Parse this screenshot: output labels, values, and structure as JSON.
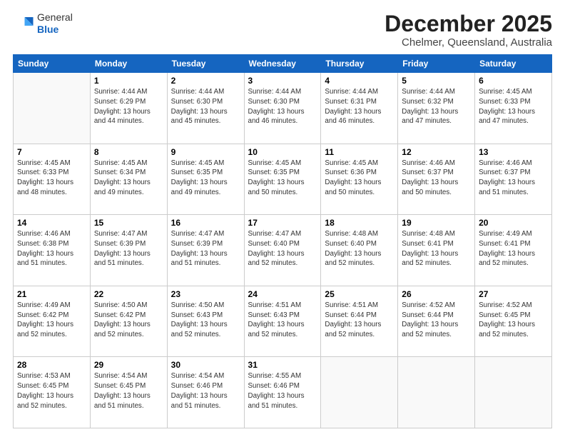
{
  "logo": {
    "general": "General",
    "blue": "Blue"
  },
  "title": "December 2025",
  "location": "Chelmer, Queensland, Australia",
  "days_header": [
    "Sunday",
    "Monday",
    "Tuesday",
    "Wednesday",
    "Thursday",
    "Friday",
    "Saturday"
  ],
  "weeks": [
    [
      {
        "num": "",
        "sunrise": "",
        "sunset": "",
        "daylight": "",
        "empty": true
      },
      {
        "num": "1",
        "sunrise": "Sunrise: 4:44 AM",
        "sunset": "Sunset: 6:29 PM",
        "daylight": "Daylight: 13 hours and 44 minutes."
      },
      {
        "num": "2",
        "sunrise": "Sunrise: 4:44 AM",
        "sunset": "Sunset: 6:30 PM",
        "daylight": "Daylight: 13 hours and 45 minutes."
      },
      {
        "num": "3",
        "sunrise": "Sunrise: 4:44 AM",
        "sunset": "Sunset: 6:30 PM",
        "daylight": "Daylight: 13 hours and 46 minutes."
      },
      {
        "num": "4",
        "sunrise": "Sunrise: 4:44 AM",
        "sunset": "Sunset: 6:31 PM",
        "daylight": "Daylight: 13 hours and 46 minutes."
      },
      {
        "num": "5",
        "sunrise": "Sunrise: 4:44 AM",
        "sunset": "Sunset: 6:32 PM",
        "daylight": "Daylight: 13 hours and 47 minutes."
      },
      {
        "num": "6",
        "sunrise": "Sunrise: 4:45 AM",
        "sunset": "Sunset: 6:33 PM",
        "daylight": "Daylight: 13 hours and 47 minutes."
      }
    ],
    [
      {
        "num": "7",
        "sunrise": "Sunrise: 4:45 AM",
        "sunset": "Sunset: 6:33 PM",
        "daylight": "Daylight: 13 hours and 48 minutes."
      },
      {
        "num": "8",
        "sunrise": "Sunrise: 4:45 AM",
        "sunset": "Sunset: 6:34 PM",
        "daylight": "Daylight: 13 hours and 49 minutes."
      },
      {
        "num": "9",
        "sunrise": "Sunrise: 4:45 AM",
        "sunset": "Sunset: 6:35 PM",
        "daylight": "Daylight: 13 hours and 49 minutes."
      },
      {
        "num": "10",
        "sunrise": "Sunrise: 4:45 AM",
        "sunset": "Sunset: 6:35 PM",
        "daylight": "Daylight: 13 hours and 50 minutes."
      },
      {
        "num": "11",
        "sunrise": "Sunrise: 4:45 AM",
        "sunset": "Sunset: 6:36 PM",
        "daylight": "Daylight: 13 hours and 50 minutes."
      },
      {
        "num": "12",
        "sunrise": "Sunrise: 4:46 AM",
        "sunset": "Sunset: 6:37 PM",
        "daylight": "Daylight: 13 hours and 50 minutes."
      },
      {
        "num": "13",
        "sunrise": "Sunrise: 4:46 AM",
        "sunset": "Sunset: 6:37 PM",
        "daylight": "Daylight: 13 hours and 51 minutes."
      }
    ],
    [
      {
        "num": "14",
        "sunrise": "Sunrise: 4:46 AM",
        "sunset": "Sunset: 6:38 PM",
        "daylight": "Daylight: 13 hours and 51 minutes."
      },
      {
        "num": "15",
        "sunrise": "Sunrise: 4:47 AM",
        "sunset": "Sunset: 6:39 PM",
        "daylight": "Daylight: 13 hours and 51 minutes."
      },
      {
        "num": "16",
        "sunrise": "Sunrise: 4:47 AM",
        "sunset": "Sunset: 6:39 PM",
        "daylight": "Daylight: 13 hours and 51 minutes."
      },
      {
        "num": "17",
        "sunrise": "Sunrise: 4:47 AM",
        "sunset": "Sunset: 6:40 PM",
        "daylight": "Daylight: 13 hours and 52 minutes."
      },
      {
        "num": "18",
        "sunrise": "Sunrise: 4:48 AM",
        "sunset": "Sunset: 6:40 PM",
        "daylight": "Daylight: 13 hours and 52 minutes."
      },
      {
        "num": "19",
        "sunrise": "Sunrise: 4:48 AM",
        "sunset": "Sunset: 6:41 PM",
        "daylight": "Daylight: 13 hours and 52 minutes."
      },
      {
        "num": "20",
        "sunrise": "Sunrise: 4:49 AM",
        "sunset": "Sunset: 6:41 PM",
        "daylight": "Daylight: 13 hours and 52 minutes."
      }
    ],
    [
      {
        "num": "21",
        "sunrise": "Sunrise: 4:49 AM",
        "sunset": "Sunset: 6:42 PM",
        "daylight": "Daylight: 13 hours and 52 minutes."
      },
      {
        "num": "22",
        "sunrise": "Sunrise: 4:50 AM",
        "sunset": "Sunset: 6:42 PM",
        "daylight": "Daylight: 13 hours and 52 minutes."
      },
      {
        "num": "23",
        "sunrise": "Sunrise: 4:50 AM",
        "sunset": "Sunset: 6:43 PM",
        "daylight": "Daylight: 13 hours and 52 minutes."
      },
      {
        "num": "24",
        "sunrise": "Sunrise: 4:51 AM",
        "sunset": "Sunset: 6:43 PM",
        "daylight": "Daylight: 13 hours and 52 minutes."
      },
      {
        "num": "25",
        "sunrise": "Sunrise: 4:51 AM",
        "sunset": "Sunset: 6:44 PM",
        "daylight": "Daylight: 13 hours and 52 minutes."
      },
      {
        "num": "26",
        "sunrise": "Sunrise: 4:52 AM",
        "sunset": "Sunset: 6:44 PM",
        "daylight": "Daylight: 13 hours and 52 minutes."
      },
      {
        "num": "27",
        "sunrise": "Sunrise: 4:52 AM",
        "sunset": "Sunset: 6:45 PM",
        "daylight": "Daylight: 13 hours and 52 minutes."
      }
    ],
    [
      {
        "num": "28",
        "sunrise": "Sunrise: 4:53 AM",
        "sunset": "Sunset: 6:45 PM",
        "daylight": "Daylight: 13 hours and 52 minutes."
      },
      {
        "num": "29",
        "sunrise": "Sunrise: 4:54 AM",
        "sunset": "Sunset: 6:45 PM",
        "daylight": "Daylight: 13 hours and 51 minutes."
      },
      {
        "num": "30",
        "sunrise": "Sunrise: 4:54 AM",
        "sunset": "Sunset: 6:46 PM",
        "daylight": "Daylight: 13 hours and 51 minutes."
      },
      {
        "num": "31",
        "sunrise": "Sunrise: 4:55 AM",
        "sunset": "Sunset: 6:46 PM",
        "daylight": "Daylight: 13 hours and 51 minutes."
      },
      {
        "num": "",
        "sunrise": "",
        "sunset": "",
        "daylight": "",
        "empty": true
      },
      {
        "num": "",
        "sunrise": "",
        "sunset": "",
        "daylight": "",
        "empty": true
      },
      {
        "num": "",
        "sunrise": "",
        "sunset": "",
        "daylight": "",
        "empty": true
      }
    ]
  ]
}
